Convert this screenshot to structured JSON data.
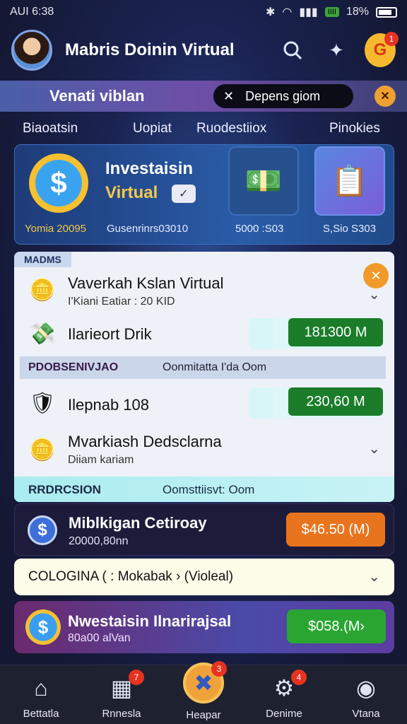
{
  "status_bar": {
    "time": "AUI 6:38",
    "battery_chip": "IIII",
    "battery_pct": "18%"
  },
  "header": {
    "title": "Mabris Doinin Virtual",
    "notif_count": "1"
  },
  "banner": {
    "title": "Venati viblan",
    "search_value": "Depens giom"
  },
  "tabs": [
    "Biaoatsin",
    "Uopiat",
    "Ruodestiiox",
    "Pinokies"
  ],
  "hero": {
    "title": "Investaisin",
    "subtitle": "Virtual",
    "year": "Yomia 20095",
    "caption_1": "Gusenrinrs03010",
    "caption_2": "5000 :S03",
    "caption_3": "S,Sio S303"
  },
  "panel": {
    "badge": "MADMS",
    "row1": {
      "title": "Vaverkah Kslan Virtual",
      "sub": "I'Kiani Eatiar : 20 KID"
    },
    "row2": {
      "title": "Ilarieort Drik",
      "amount": "181300 M"
    },
    "strip1": {
      "label": "PDOBSENIVJAO",
      "value": "Oonmitatta I'da Oom"
    },
    "row3": {
      "title": "Ilepnab 108",
      "amount": "230,60 M"
    },
    "row4": {
      "title": "Mvarkiash Dedsclarna",
      "sub": "Diiam kariam"
    },
    "footer": {
      "label": "RRDRCSION",
      "value": "Oomsttiisvt: Oom"
    }
  },
  "card_dark": {
    "title": "Miblkigan Cetiroay",
    "sub": "20000,80nn",
    "button": "$46.50 (M)"
  },
  "dropdown": {
    "text": "COLOGINA ( : Mokabak › (Violeal)"
  },
  "card_purple": {
    "title": "Nwestaisin Ilnarirajsal",
    "sub": "80a00 alVan",
    "button": "$058.(M›"
  },
  "bottom_nav": [
    {
      "label": "Bettatla",
      "icon": "home-icon",
      "badge": ""
    },
    {
      "label": "Rnnesla",
      "icon": "chart-building-icon",
      "badge": "7"
    },
    {
      "label": "Heapar",
      "icon": "exchange-icon",
      "badge": "3"
    },
    {
      "label": "Denime",
      "icon": "gear-icon",
      "badge": "4"
    },
    {
      "label": "Vtana",
      "icon": "profile-icon",
      "badge": ""
    }
  ],
  "colors": {
    "accent_orange": "#e8741e",
    "accent_green": "#1b7d2a",
    "background": "#1b1f3b",
    "gold": "#f5c84a"
  }
}
